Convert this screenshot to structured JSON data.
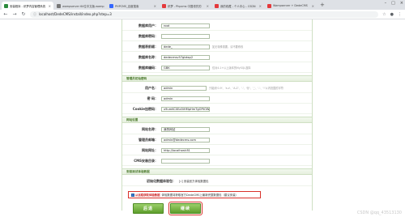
{
  "browser": {
    "tabs": [
      {
        "label": "安装程序 - 织梦内容管理系统",
        "active": true,
        "color": "#2c8a3c"
      },
      {
        "label": "wampserver 64位中文版-wamp",
        "active": false,
        "color": "#777777"
      },
      {
        "label": "PHPCMS_百度搜索",
        "active": false,
        "color": "#3366ff"
      },
      {
        "label": "织梦 - Phpcms 中国领先的",
        "active": false,
        "color": "#e4393c"
      },
      {
        "label": "我的收藏 - 个人中心 - CSDN",
        "active": false,
        "color": "#e4393c"
      },
      {
        "label": "Wampserver + DedeCMS",
        "active": false,
        "color": "#e4393c"
      }
    ],
    "new_tab": "+",
    "url": "localhost/DedeCMS/install/index.php?step=3"
  },
  "db_rows": [
    {
      "label": "数据库用户：",
      "value": "root",
      "hint": ""
    },
    {
      "label": "数据库密码：",
      "value": "",
      "hint": ""
    },
    {
      "label": "数据表前缀：",
      "value": "dede_",
      "hint": "如无特殊需要，请不要修改"
    },
    {
      "label": "数据库名称：",
      "value": "dedecmsv57gbksp2",
      "hint": ""
    },
    {
      "label": "数据库编码：",
      "value": "GBK",
      "hint": "仅对4.1+以上版本的MySQL选择"
    }
  ],
  "admin_section": {
    "title": "管理员初始密码",
    "rows": [
      {
        "label": "用户名：",
        "value": "admin",
        "hint": "只能用'0-9'、'a-z'、'A-Z'、'.'、'@'、'_'、'-'、'!'以内范围的字符"
      },
      {
        "label": "密  码：",
        "value": "admin",
        "hint": ""
      },
      {
        "label": "Cookie加密码：",
        "value": "x9umKC0Ea5iHMpHmTgOPtOWt5B",
        "hint": ""
      }
    ]
  },
  "site_section": {
    "title": "网站设置",
    "rows": [
      {
        "label": "网站名称：",
        "value": "我的网站",
        "hint": ""
      },
      {
        "label": "管理员邮箱：",
        "value": "admin@dedecms.com",
        "hint": ""
      },
      {
        "label": "网站网址：",
        "value": "http://localhost:81",
        "hint": ""
      },
      {
        "label": "CMS安装目录：",
        "value": "",
        "hint": ""
      }
    ]
  },
  "demo_section": {
    "title": "安装测试体验数据",
    "row_label": "初始化数据体验包：",
    "row_text": "[√] 安装官方体验数据包"
  },
  "remote_checkbox": {
    "prefix": "从远程获取体验数据",
    "text": "体验数据将获取官方DedeCMS上最新完整数据包（建议安装）"
  },
  "buttons": {
    "back": "后退",
    "next": "继续"
  },
  "watermark": "CSDN @qq_43513130",
  "colors": {
    "accent_green": "#5e9e2c",
    "highlight_red": "#d9322b"
  }
}
